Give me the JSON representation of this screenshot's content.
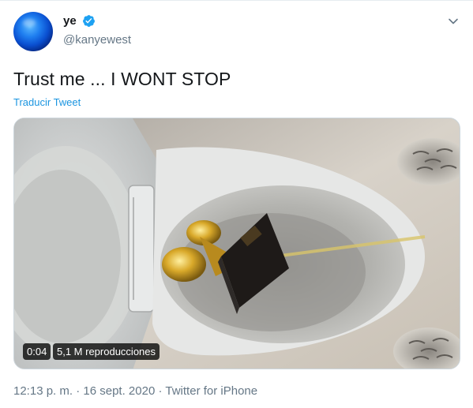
{
  "tweet": {
    "display_name": "ye",
    "handle": "@kanyewest",
    "text": "Trust me ... I WONT STOP",
    "translate_label": "Traducir Tweet"
  },
  "media": {
    "duration": "0:04",
    "views": "5,1 M reproducciones"
  },
  "meta": {
    "time": "12:13 p. m.",
    "separator": "·",
    "date": "16 sept. 2020",
    "source": "Twitter for iPhone"
  },
  "icons": {
    "verified": "verified-badge-icon",
    "caret": "chevron-down-icon"
  },
  "colors": {
    "link": "#1b95e0",
    "verified": "#1da1f2",
    "secondary_text": "#657786"
  }
}
